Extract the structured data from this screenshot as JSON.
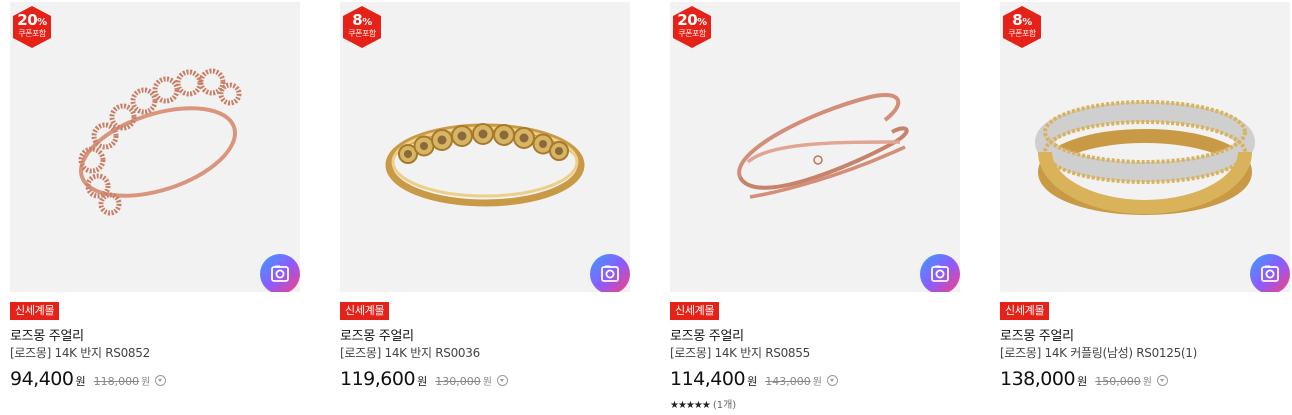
{
  "products": [
    {
      "discount_number": "20",
      "discount_unit": "%",
      "coupon_label": "쿠폰포함",
      "tag": "신세계몰",
      "brand": "로즈몽 주얼리",
      "title": "[로즈몽] 14K 반지 RS0852",
      "price": "94,400",
      "price_unit": "원",
      "original_price": "118,000",
      "original_unit": "원",
      "ring_style": "rose-circles"
    },
    {
      "discount_number": "8",
      "discount_unit": "%",
      "coupon_label": "쿠폰포함",
      "tag": "신세계몰",
      "brand": "로즈몽 주얼리",
      "title": "[로즈몽] 14K 반지 RS0036",
      "price": "119,600",
      "price_unit": "원",
      "original_price": "130,000",
      "original_unit": "원",
      "ring_style": "gold-stones"
    },
    {
      "discount_number": "20",
      "discount_unit": "%",
      "coupon_label": "쿠폰포함",
      "tag": "신세계몰",
      "brand": "로즈몽 주얼리",
      "title": "[로즈몽] 14K 반지 RS0855",
      "price": "114,400",
      "price_unit": "원",
      "original_price": "143,000",
      "original_unit": "원",
      "rating_stars": "★★★★★",
      "rating_count": "(1개)",
      "ring_style": "rose-crossover"
    },
    {
      "discount_number": "8",
      "discount_unit": "%",
      "coupon_label": "쿠폰포함",
      "tag": "신세계몰",
      "brand": "로즈몽 주얼리",
      "title": "[로즈몽] 14K 커플링(남성) RS0125(1)",
      "price": "138,000",
      "price_unit": "원",
      "original_price": "150,000",
      "original_unit": "원",
      "ring_style": "two-tone-band"
    }
  ],
  "colors": {
    "badge_red": "#e62117",
    "tag_red": "#e62117",
    "thumb_bg": "#f2f2f2",
    "rose_gold": "#d9957e",
    "gold": "#d8b465",
    "white_gold": "#cfcfcf"
  },
  "icons": {
    "camera": "camera-search-icon",
    "info": "chevron-down-circle-icon"
  }
}
